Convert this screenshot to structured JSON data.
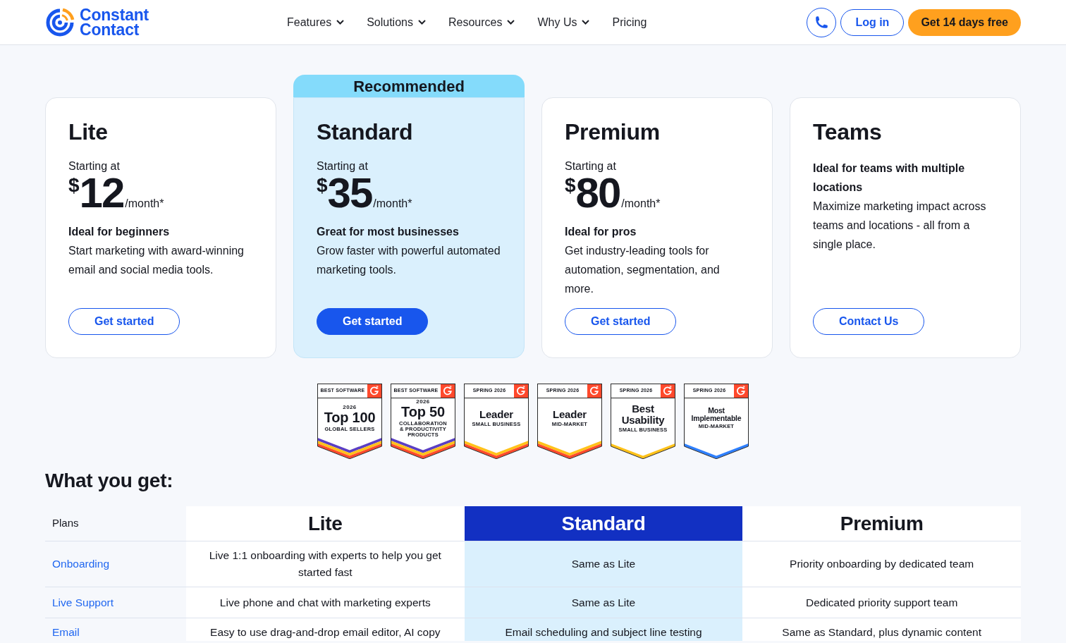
{
  "header": {
    "logo_text": "Constant Contact",
    "nav": [
      {
        "label": "Features",
        "dropdown": true
      },
      {
        "label": "Solutions",
        "dropdown": true
      },
      {
        "label": "Resources",
        "dropdown": true
      },
      {
        "label": "Why Us",
        "dropdown": true
      },
      {
        "label": "Pricing",
        "dropdown": false
      }
    ],
    "login": "Log in",
    "trial": "Get 14 days free"
  },
  "plans": [
    {
      "kind": "priced",
      "name": "Lite",
      "highlighted": false,
      "starting_label": "Starting at",
      "currency": "$",
      "price": "12",
      "period": "/month*",
      "tagline": "Ideal for beginners",
      "description": "Start marketing with award-winning email and social media tools.",
      "button": "Get started"
    },
    {
      "kind": "priced",
      "name": "Standard",
      "highlighted": true,
      "ribbon": "Recommended",
      "starting_label": "Starting at",
      "currency": "$",
      "price": "35",
      "period": "/month*",
      "tagline": "Great for most businesses",
      "description": "Grow faster with powerful automated marketing tools.",
      "button": "Get started"
    },
    {
      "kind": "priced",
      "name": "Premium",
      "highlighted": false,
      "starting_label": "Starting at",
      "currency": "$",
      "price": "80",
      "period": "/month*",
      "tagline": "Ideal for pros",
      "description": "Get industry-leading tools for automation, segmentation, and more.",
      "button": "Get started"
    },
    {
      "kind": "contact",
      "name": "Teams",
      "highlighted": false,
      "tagline": "Ideal for teams with multiple locations",
      "description": "Maximize marketing impact across teams and locations - all from a single place.",
      "button": "Contact Us"
    }
  ],
  "badges": [
    {
      "header": "BEST SOFTWARE",
      "year": "2026",
      "title": "Top 100",
      "subtitle": "GLOBAL SELLERS",
      "stripes": [
        {
          "color": "#5b3fc4"
        },
        {
          "color": "#ffc21a"
        },
        {
          "color": "#ff4a2b"
        }
      ]
    },
    {
      "header": "BEST SOFTWARE",
      "year": "2026",
      "title": "Top 50",
      "subtitle": "COLLABORATION\n& PRODUCTIVITY\nPRODUCTS",
      "stripes": [
        {
          "color": "#5b3fc4"
        },
        {
          "color": "#ffc21a"
        },
        {
          "color": "#ff4a2b"
        }
      ]
    },
    {
      "header": "SPRING 2026",
      "title": "Leader",
      "subtitle": "SMALL BUSINESS",
      "stripes": [
        {
          "color": "#ffc21a"
        },
        {
          "color": "#ff4a2b"
        }
      ]
    },
    {
      "header": "SPRING 2026",
      "title": "Leader",
      "subtitle": "MID-MARKET",
      "stripes": [
        {
          "color": "#ffc21a"
        },
        {
          "color": "#ff4a2b"
        }
      ]
    },
    {
      "header": "SPRING 2026",
      "title": "Best\nUsability",
      "subtitle": "SMALL BUSINESS",
      "stripes": [
        {
          "color": "#ffc21a"
        }
      ]
    },
    {
      "header": "SPRING 2026",
      "title": "Most\nImplementable",
      "subtitle": "MID-MARKET",
      "stripes": [
        {
          "color": "#2f80ff"
        }
      ]
    }
  ],
  "comparison": {
    "heading": "What you get:",
    "corner_label": "Plans",
    "columns": [
      {
        "label": "Lite",
        "highlighted": false
      },
      {
        "label": "Standard",
        "highlighted": true
      },
      {
        "label": "Premium",
        "highlighted": false
      }
    ],
    "rows": [
      {
        "feature": "Onboarding",
        "cells": [
          "Live 1:1 onboarding with experts to help you get started fast",
          "Same as Lite",
          "Priority onboarding by dedicated team"
        ]
      },
      {
        "feature": "Live Support",
        "cells": [
          "Live phone and chat with marketing experts",
          "Same as Lite",
          "Dedicated priority support team"
        ]
      },
      {
        "feature": "Email",
        "cells": [
          "Easy to use drag-and-drop email editor, AI copy",
          "Email scheduling and subject line testing",
          "Same as Standard, plus dynamic content"
        ]
      }
    ]
  }
}
